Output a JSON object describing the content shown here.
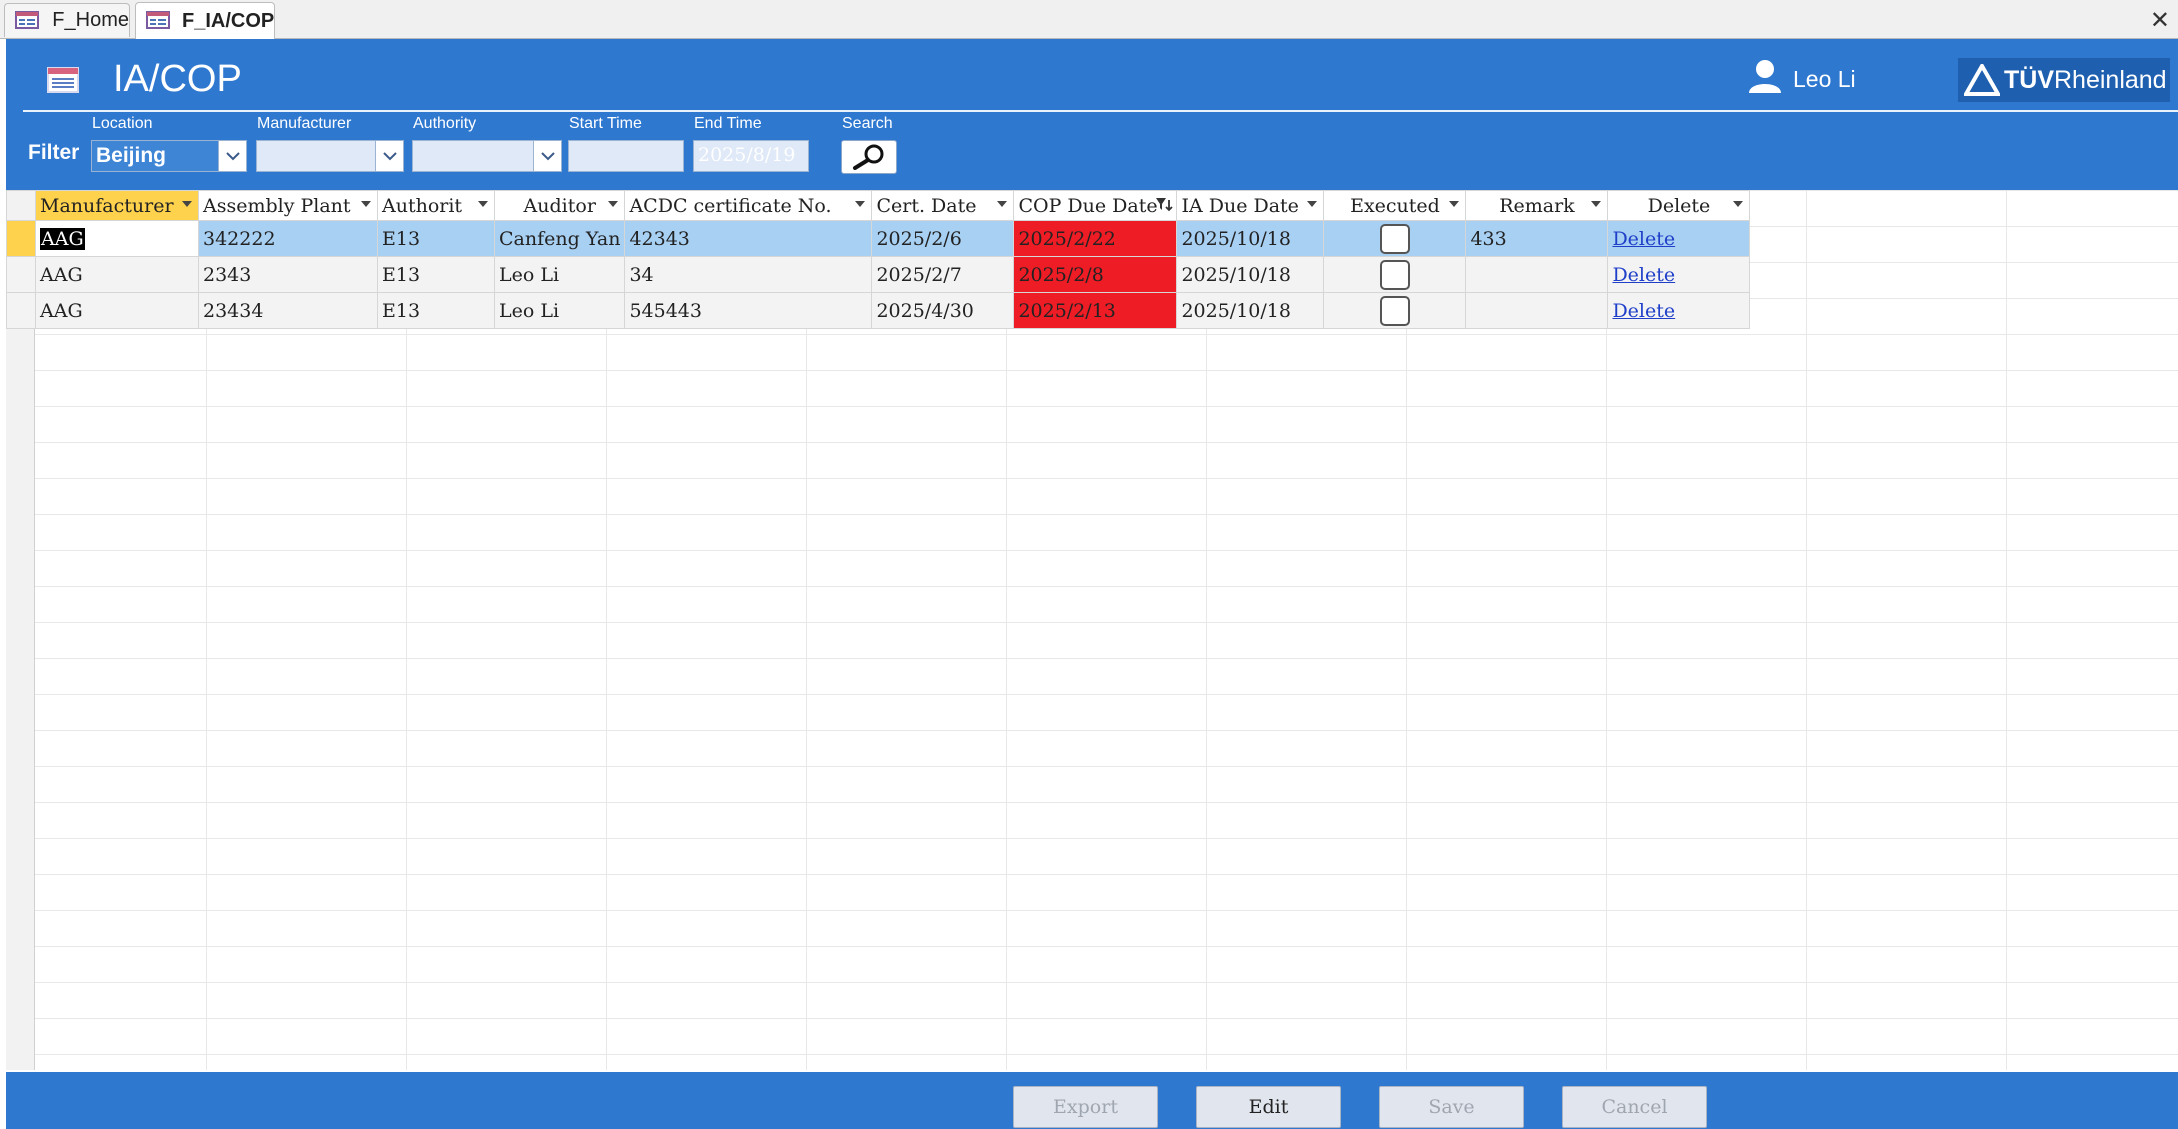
{
  "tabs": [
    {
      "label": "F_Home"
    },
    {
      "label": "F_IA/COP"
    }
  ],
  "header": {
    "title": "IA/COP",
    "user_name": "Leo Li",
    "logo_text_a": "TÜV",
    "logo_text_b": "Rheinland"
  },
  "filter": {
    "label": "Filter",
    "location_label": "Location",
    "location_value": "Beijing",
    "manufacturer_label": "Manufacturer",
    "manufacturer_value": "",
    "authority_label": "Authority",
    "authority_value": "",
    "start_time_label": "Start Time",
    "start_time_value": "",
    "end_time_label": "End Time",
    "end_time_value": "2025/8/19",
    "search_label": "Search"
  },
  "columns": {
    "manufacturer": "Manufacturer",
    "assembly_plant": "Assembly Plant",
    "authority": "Authorit",
    "auditor": "Auditor",
    "acdc_cert": "ACDC certificate No.",
    "cert_date": "Cert. Date",
    "cop_due_date": "COP Due Date",
    "ia_due_date": "IA Due Date",
    "executed": "Executed",
    "remark": "Remark",
    "delete": "Delete"
  },
  "rows": [
    {
      "manufacturer": "AAG",
      "assembly_plant": "342222",
      "authority": "E13",
      "auditor": "Canfeng Yan",
      "acdc_cert": "42343",
      "cert_date": "2025/2/6",
      "cop_due_date": "2025/2/22",
      "ia_due_date": "2025/10/18",
      "executed": false,
      "remark": "433",
      "delete": "Delete"
    },
    {
      "manufacturer": "AAG",
      "assembly_plant": "2343",
      "authority": "E13",
      "auditor": "Leo Li",
      "acdc_cert": "34",
      "cert_date": "2025/2/7",
      "cop_due_date": "2025/2/8",
      "ia_due_date": "2025/10/18",
      "executed": false,
      "remark": "",
      "delete": "Delete"
    },
    {
      "manufacturer": "AAG",
      "assembly_plant": "23434",
      "authority": "E13",
      "auditor": "Leo Li",
      "acdc_cert": "545443",
      "cert_date": "2025/4/30",
      "cop_due_date": "2025/2/13",
      "ia_due_date": "2025/10/18",
      "executed": false,
      "remark": "",
      "delete": "Delete"
    }
  ],
  "footer": {
    "export_label": "Export",
    "edit_label": "Edit",
    "save_label": "Save",
    "cancel_label": "Cancel"
  },
  "colors": {
    "header_blue": "#2f78d0",
    "overdue_red": "#ee1c25",
    "selected_row": "#a8d0f3",
    "current_record": "#ffd24d"
  },
  "icons": [
    "form-icon",
    "user-icon",
    "search-icon",
    "chevron-down-icon",
    "close-icon",
    "filter-icon"
  ]
}
